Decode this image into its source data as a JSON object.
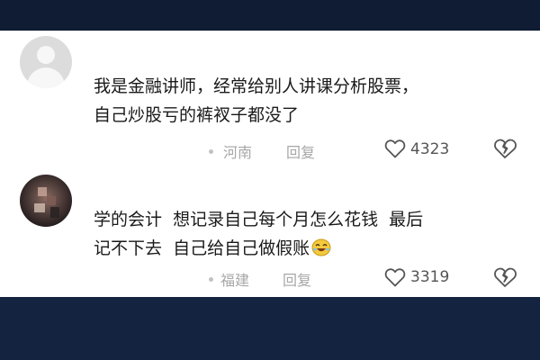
{
  "colors": {
    "panel_bg": "#ffffff",
    "frame_bg": "#13213a",
    "text": "#1a1a1a",
    "meta_text": "#a7a7a7"
  },
  "comments": [
    {
      "avatar": "default-avatar-icon",
      "line1": "我是金融讲师，经常给别人讲课分析股票，",
      "line2": "自己炒股亏的裤衩子都没了",
      "location": "河南",
      "reply_label": "回复",
      "likes": "4323"
    },
    {
      "avatar": "blurred-photo-avatar",
      "line1": "学的会计  想记录自己每个月怎么花钱  最后",
      "line2": "记不下去  自己给自己做假账",
      "emoji": "laughing-emoji-icon",
      "location": "福建",
      "reply_label": "回复",
      "likes": "3319"
    }
  ]
}
